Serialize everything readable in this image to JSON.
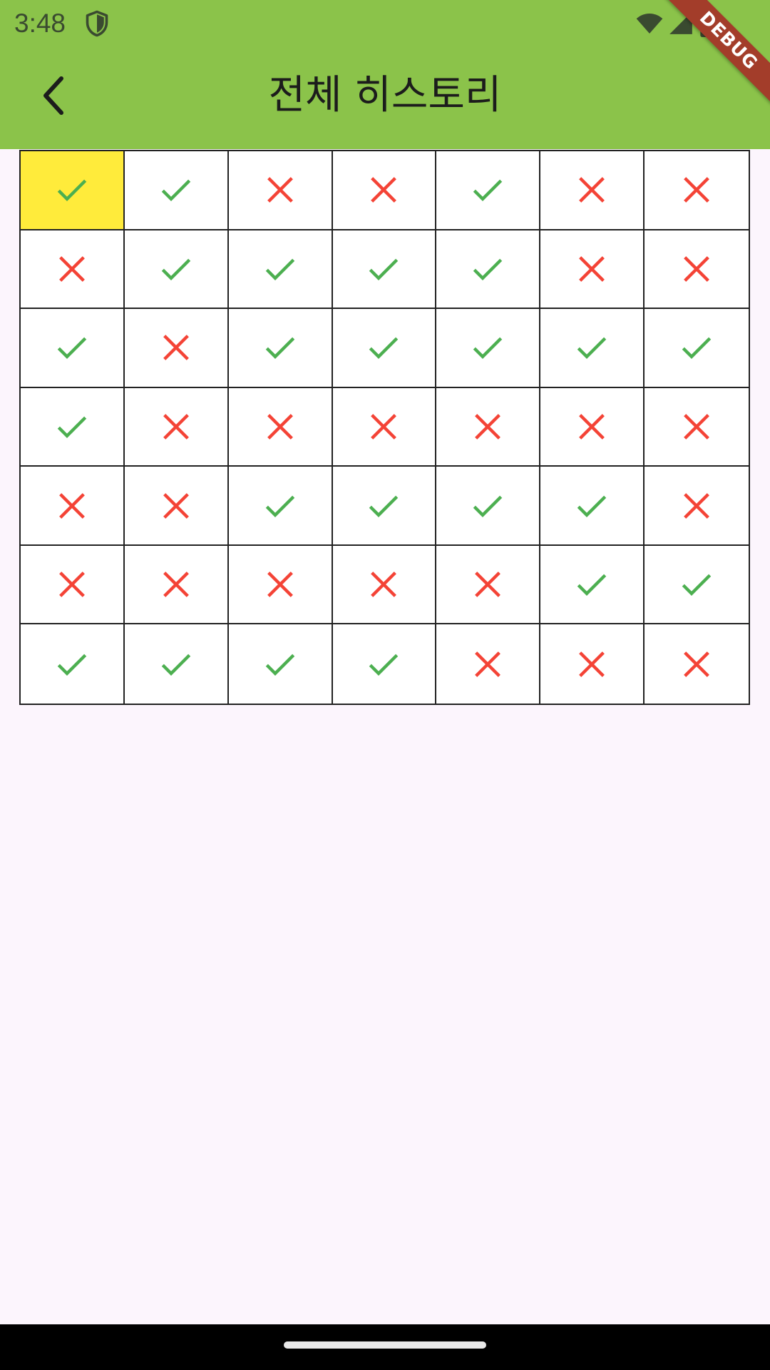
{
  "status_bar": {
    "time": "3:48"
  },
  "app_bar": {
    "title": "전체 히스토리",
    "back_icon": "arrow-back-icon",
    "color": "#8bc34a"
  },
  "debug_banner": {
    "label": "DEBUG",
    "color": "#a33d2a"
  },
  "history_grid": {
    "highlight_color": "#ffeb3b",
    "check_color": "#4caf50",
    "cross_color": "#f44336",
    "highlighted_cell": [
      0,
      0
    ],
    "rows": [
      [
        "check",
        "check",
        "cross",
        "cross",
        "check",
        "cross",
        "cross"
      ],
      [
        "cross",
        "check",
        "check",
        "check",
        "check",
        "cross",
        "cross"
      ],
      [
        "check",
        "cross",
        "check",
        "check",
        "check",
        "check",
        "check"
      ],
      [
        "check",
        "cross",
        "cross",
        "cross",
        "cross",
        "cross",
        "cross"
      ],
      [
        "cross",
        "cross",
        "check",
        "check",
        "check",
        "check",
        "cross"
      ],
      [
        "cross",
        "cross",
        "cross",
        "cross",
        "cross",
        "check",
        "check"
      ],
      [
        "check",
        "check",
        "check",
        "check",
        "cross",
        "cross",
        "cross"
      ]
    ]
  }
}
